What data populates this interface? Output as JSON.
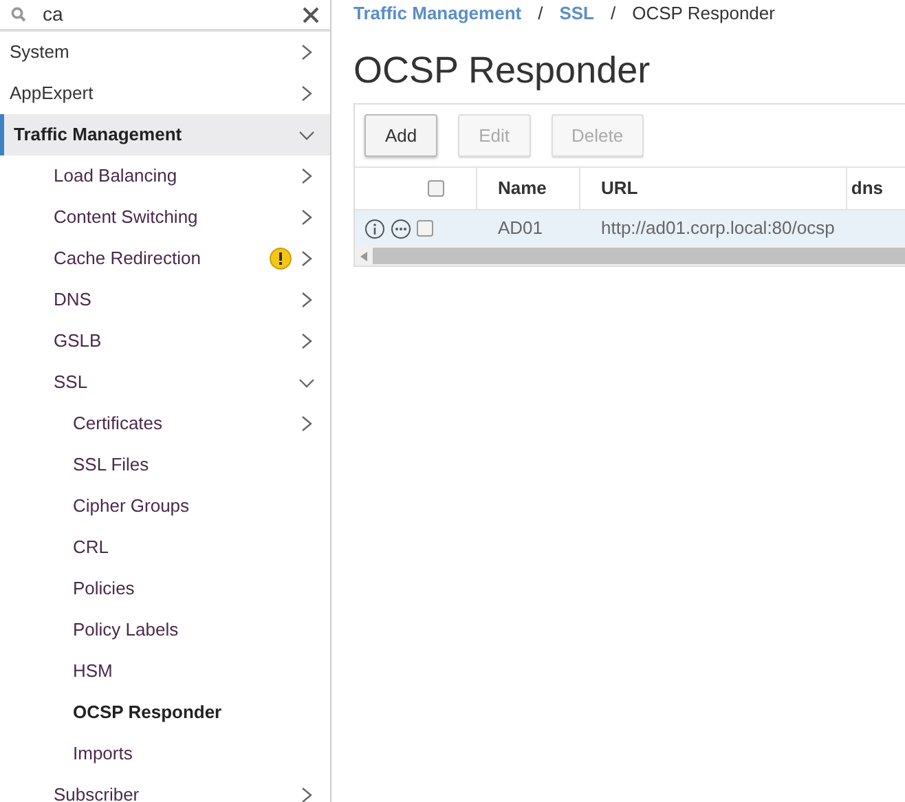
{
  "search": {
    "value": "ca"
  },
  "nav": [
    {
      "label": "System",
      "kind": "group",
      "expanded": false,
      "selected": false,
      "warning": false
    },
    {
      "label": "AppExpert",
      "kind": "group",
      "expanded": false,
      "selected": false,
      "warning": false
    },
    {
      "label": "Traffic Management",
      "kind": "group",
      "expanded": true,
      "selected": true,
      "warning": false,
      "children": [
        {
          "label": "Load Balancing",
          "kind": "group",
          "expanded": false,
          "selected": false,
          "warning": false
        },
        {
          "label": "Content Switching",
          "kind": "group",
          "expanded": false,
          "selected": false,
          "warning": false
        },
        {
          "label": "Cache Redirection",
          "kind": "group",
          "expanded": false,
          "selected": false,
          "warning": true
        },
        {
          "label": "DNS",
          "kind": "group",
          "expanded": false,
          "selected": false,
          "warning": false
        },
        {
          "label": "GSLB",
          "kind": "group",
          "expanded": false,
          "selected": false,
          "warning": false
        },
        {
          "label": "SSL",
          "kind": "group",
          "expanded": true,
          "selected": false,
          "warning": false,
          "children": [
            {
              "label": "Certificates",
              "kind": "group",
              "expanded": false,
              "selected": false,
              "warning": false
            },
            {
              "label": "SSL Files",
              "kind": "page",
              "selected": false,
              "warning": false
            },
            {
              "label": "Cipher Groups",
              "kind": "page",
              "selected": false,
              "warning": false
            },
            {
              "label": "CRL",
              "kind": "page",
              "selected": false,
              "warning": false
            },
            {
              "label": "Policies",
              "kind": "page",
              "selected": false,
              "warning": false
            },
            {
              "label": "Policy Labels",
              "kind": "page",
              "selected": false,
              "warning": false
            },
            {
              "label": "HSM",
              "kind": "page",
              "selected": false,
              "warning": false
            },
            {
              "label": "OCSP Responder",
              "kind": "page",
              "selected": true,
              "warning": false
            },
            {
              "label": "Imports",
              "kind": "page",
              "selected": false,
              "warning": false
            }
          ]
        },
        {
          "label": "Subscriber",
          "kind": "group",
          "expanded": false,
          "selected": false,
          "warning": false
        }
      ]
    }
  ],
  "breadcrumb": [
    {
      "label": "Traffic Management",
      "kind": "link"
    },
    {
      "label": "/",
      "kind": "separator"
    },
    {
      "label": "SSL",
      "kind": "link"
    },
    {
      "label": "/",
      "kind": "separator"
    },
    {
      "label": "OCSP Responder",
      "kind": "current"
    }
  ],
  "title": "OCSP Responder",
  "buttons": [
    {
      "label": "Add",
      "disabled": false
    },
    {
      "label": "Edit",
      "disabled": true
    },
    {
      "label": "Delete",
      "disabled": true
    }
  ],
  "table": {
    "header_checked": false,
    "columns": [
      "Name",
      "URL",
      "dns"
    ],
    "rows": [
      {
        "checked": false,
        "hovered": true,
        "cells": [
          "AD01",
          "http://ad01.corp.local:80/ocsp",
          null
        ]
      }
    ]
  }
}
